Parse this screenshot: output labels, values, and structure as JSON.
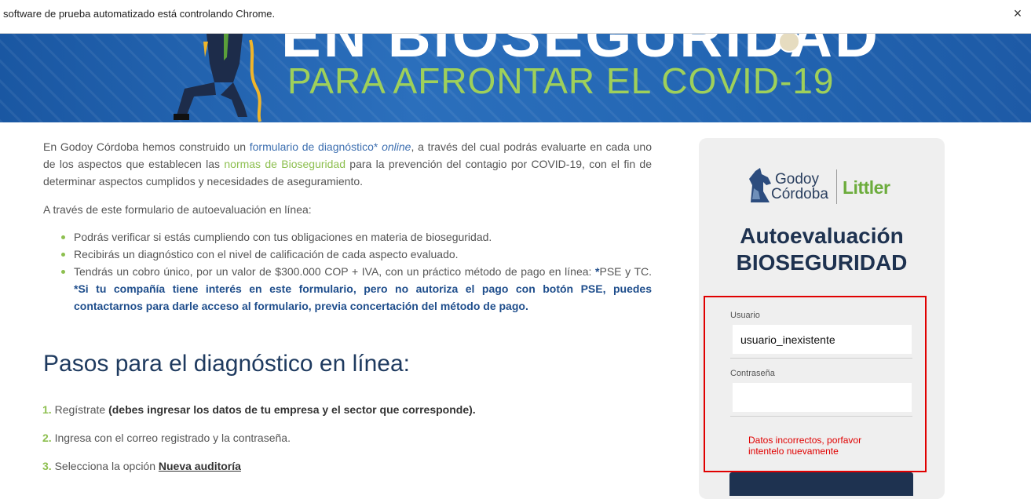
{
  "infobar": {
    "text": "software de prueba automatizado está controlando Chrome.",
    "close_glyph": "×"
  },
  "banner": {
    "title_top": "EN BIOSEGURIDAD",
    "title_sub": "PARA AFRONTAR EL COVID-19"
  },
  "intro": {
    "p1_a": "En Godoy Córdoba hemos construido un ",
    "p1_link1": "formulario de diagnóstico* ",
    "p1_link1_em": "online",
    "p1_b": ", a través del cual podrás evaluarte en cada uno de los aspectos que establecen las ",
    "p1_link2": "normas de Bioseguridad",
    "p1_c": " para la prevención del contagio por COVID-19, con el fin de determinar aspectos cumplidos y necesidades de aseguramiento.",
    "p2": "A través de este formulario de autoevaluación en línea:"
  },
  "bullets": [
    "Podrás verificar si estás cumpliendo con tus obligaciones en materia de bioseguridad.",
    "Recibirás un diagnóstico con el nivel de calificación de cada aspecto evaluado."
  ],
  "bullet3": {
    "a": "Tendrás un cobro único, por un valor de $300.000 COP + IVA, con un práctico método de pago en línea: ",
    "b": "*",
    "c": "PSE y TC. ",
    "d": "*Si tu compañía tiene interés en este formulario, pero no autoriza el pago con botón PSE, puedes contactarnos para darle acceso al formulario, previa concertación del método de pago."
  },
  "steps": {
    "title": "Pasos para el diagnóstico en línea:",
    "s1_num": "1.",
    "s1_text": " Regístrate ",
    "s1_bold": "(debes ingresar los datos de tu empresa y el sector que corresponde).",
    "s2_num": "2.",
    "s2_text": " Ingresa con el correo registrado y la contraseña.",
    "s3_num": "3.",
    "s3_text": " Selecciona la opción ",
    "s3_link": "Nueva auditoría"
  },
  "card": {
    "logo_godoy": "Godoy",
    "logo_cordoba": "Córdoba",
    "logo_littler": "Littler",
    "title_line1": "Autoevaluación",
    "title_line2": "BIOSEGURIDAD",
    "user_label": "Usuario",
    "user_value": "usuario_inexistente",
    "password_label": "Contraseña",
    "password_value": "",
    "error": "Datos incorrectos, porfavor intentelo nuevamente",
    "submit_label": ""
  },
  "colors": {
    "accent_green": "#8dbf4f",
    "brand_blue": "#1e3250",
    "error_red": "#e00000"
  }
}
